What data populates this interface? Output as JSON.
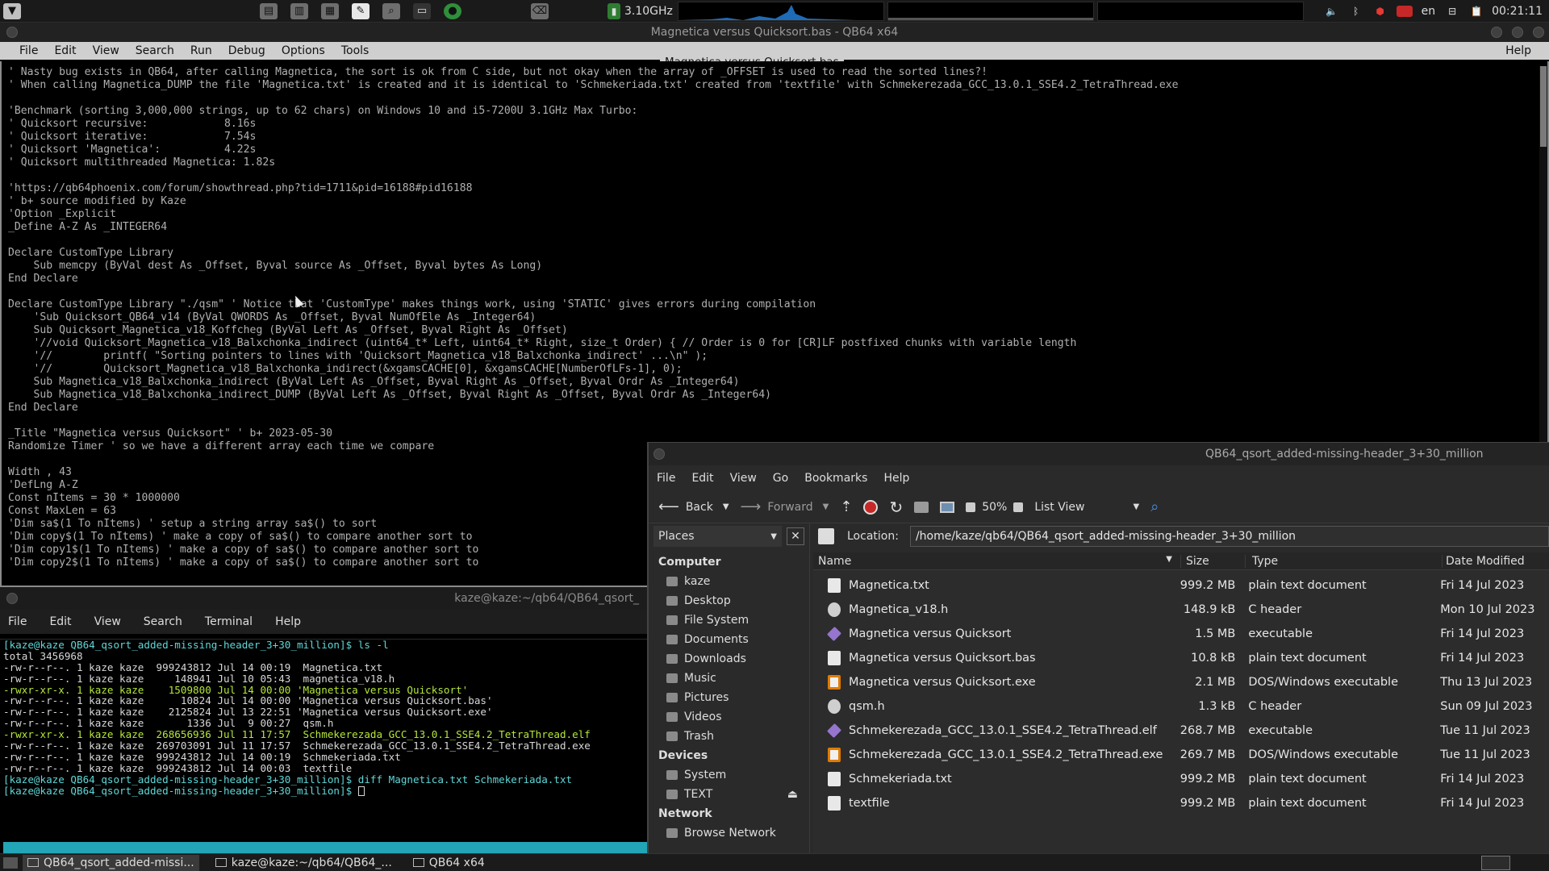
{
  "top_panel": {
    "launchers": [
      "menu-icon",
      "printer-icon",
      "document-icon",
      "calculator-icon",
      "text-editor-icon",
      "search-icon",
      "terminal-icon",
      "browser-icon",
      "trash-icon"
    ],
    "cpu_freq": "3.10GHz",
    "lang": "en",
    "clock": "00:21:11"
  },
  "editor": {
    "title": "Magnetica versus Quicksort.bas - QB64 x64",
    "tab_label": "Magnetica versus Quicksort.bas",
    "menu": [
      "File",
      "Edit",
      "View",
      "Search",
      "Run",
      "Debug",
      "Options",
      "Tools"
    ],
    "help": "Help",
    "lines": [
      "' Nasty bug exists in QB64, after calling Magnetica, the sort is ok from C side, but not okay when the array of _OFFSET is used to read the sorted lines?!",
      "' When calling Magnetica_DUMP the file 'Magnetica.txt' is created and it is identical to 'Schmekeriada.txt' created from 'textfile' with Schmekerezada_GCC_13.0.1_SSE4.2_TetraThread.exe",
      "",
      "'Benchmark (sorting 3,000,000 strings, up to 62 chars) on Windows 10 and i5-7200U 3.1GHz Max Turbo:",
      "' Quicksort recursive:            8.16s",
      "' Quicksort iterative:            7.54s",
      "' Quicksort 'Magnetica':          4.22s",
      "' Quicksort multithreaded Magnetica: 1.82s",
      "",
      "'https://qb64phoenix.com/forum/showthread.php?tid=1711&pid=16188#pid16188",
      "' b+ source modified by Kaze",
      "'Option _Explicit",
      "_Define A-Z As _INTEGER64",
      "",
      "Declare CustomType Library",
      "    Sub memcpy (ByVal dest As _Offset, Byval source As _Offset, Byval bytes As Long)",
      "End Declare",
      "",
      "Declare CustomType Library \"./qsm\" ' Notice that 'CustomType' makes things work, using 'STATIC' gives errors during compilation",
      "    'Sub Quicksort_QB64_v14 (ByVal QWORDS As _Offset, Byval NumOfEle As _Integer64)",
      "    Sub Quicksort_Magnetica_v18_Koffcheg (ByVal Left As _Offset, Byval Right As _Offset)",
      "    '//void Quicksort_Magnetica_v18_Balxchonka_indirect (uint64_t* Left, uint64_t* Right, size_t Order) { // Order is 0 for [CR]LF postfixed chunks with variable length",
      "    '//        printf( \"Sorting pointers to lines with 'Quicksort_Magnetica_v18_Balxchonka_indirect' ...\\n\" );",
      "    '//        Quicksort_Magnetica_v18_Balxchonka_indirect(&xgamsCACHE[0], &xgamsCACHE[NumberOfLFs-1], 0);",
      "    Sub Magnetica_v18_Balxchonka_indirect (ByVal Left As _Offset, Byval Right As _Offset, Byval Ordr As _Integer64)",
      "    Sub Magnetica_v18_Balxchonka_indirect_DUMP (ByVal Left As _Offset, Byval Right As _Offset, Byval Ordr As _Integer64)",
      "End Declare",
      "",
      "_Title \"Magnetica versus Quicksort\" ' b+ 2023-05-30",
      "Randomize Timer ' so we have a different array each time we compare",
      "",
      "Width , 43",
      "'DefLng A-Z",
      "Const nItems = 30 * 1000000",
      "Const MaxLen = 63",
      "'Dim sa$(1 To nItems) ' setup a string array sa$() to sort",
      "'Dim copy$(1 To nItems) ' make a copy of sa$() to compare another sort to",
      "'Dim copy1$(1 To nItems) ' make a copy of sa$() to compare another sort to",
      "'Dim copy2$(1 To nItems) ' make a copy of sa$() to compare another sort to"
    ]
  },
  "terminal": {
    "title": "kaze@kaze:~/qb64/QB64_qsort_",
    "menu": [
      "File",
      "Edit",
      "View",
      "Search",
      "Terminal",
      "Help"
    ],
    "lines": [
      {
        "t": "[kaze@kaze QB64_qsort_added-missing-header_3+30_million]$ ls -l",
        "c": "#5fd7d7"
      },
      {
        "t": "total 3456968",
        "c": "#d8d8d8"
      },
      {
        "t": "-rw-r--r--. 1 kaze kaze  999243812 Jul 14 00:19  Magnetica.txt",
        "c": "#d8d8d8"
      },
      {
        "t": "-rw-r--r--. 1 kaze kaze     148941 Jul 10 05:43  magnetica_v18.h",
        "c": "#d8d8d8"
      },
      {
        "t": "-rwxr-xr-x. 1 kaze kaze    1509800 Jul 14 00:00 'Magnetica versus Quicksort'",
        "c": "#b5e83a"
      },
      {
        "t": "-rw-r--r--. 1 kaze kaze      10824 Jul 14 00:00 'Magnetica versus Quicksort.bas'",
        "c": "#d8d8d8"
      },
      {
        "t": "-rw-r--r--. 1 kaze kaze    2125824 Jul 13 22:51 'Magnetica versus Quicksort.exe'",
        "c": "#d8d8d8"
      },
      {
        "t": "-rw-r--r--. 1 kaze kaze       1336 Jul  9 00:27  qsm.h",
        "c": "#d8d8d8"
      },
      {
        "t": "-rwxr-xr-x. 1 kaze kaze  268656936 Jul 11 17:57  Schmekerezada_GCC_13.0.1_SSE4.2_TetraThread.elf",
        "c": "#b5e83a"
      },
      {
        "t": "-rw-r--r--. 1 kaze kaze  269703091 Jul 11 17:57  Schmekerezada_GCC_13.0.1_SSE4.2_TetraThread.exe",
        "c": "#d8d8d8"
      },
      {
        "t": "-rw-r--r--. 1 kaze kaze  999243812 Jul 14 00:19  Schmekeriada.txt",
        "c": "#d8d8d8"
      },
      {
        "t": "-rw-r--r--. 1 kaze kaze  999243812 Jul 14 00:03  textfile",
        "c": "#d8d8d8"
      },
      {
        "t": "[kaze@kaze QB64_qsort_added-missing-header_3+30_million]$ diff Magnetica.txt Schmekeriada.txt",
        "c": "#5fd7d7"
      },
      {
        "t": "[kaze@kaze QB64_qsort_added-missing-header_3+30_million]$ ",
        "c": "#5fd7d7"
      }
    ]
  },
  "file_manager": {
    "title": "QB64_qsort_added-missing-header_3+30_million",
    "menu": [
      "File",
      "Edit",
      "View",
      "Go",
      "Bookmarks",
      "Help"
    ],
    "toolbar": {
      "back": "Back",
      "forward": "Forward",
      "zoom": "50%",
      "view_mode": "List View"
    },
    "places_label": "Places",
    "location_label": "Location:",
    "location_value": "/home/kaze/qb64/QB64_qsort_added-missing-header_3+30_million",
    "places": [
      {
        "kind": "head",
        "label": "Computer"
      },
      {
        "kind": "item",
        "label": "kaze"
      },
      {
        "kind": "item",
        "label": "Desktop"
      },
      {
        "kind": "item",
        "label": "File System"
      },
      {
        "kind": "item",
        "label": "Documents"
      },
      {
        "kind": "item",
        "label": "Downloads"
      },
      {
        "kind": "item",
        "label": "Music"
      },
      {
        "kind": "item",
        "label": "Pictures"
      },
      {
        "kind": "item",
        "label": "Videos"
      },
      {
        "kind": "item",
        "label": "Trash"
      },
      {
        "kind": "head",
        "label": "Devices"
      },
      {
        "kind": "item",
        "label": "System"
      },
      {
        "kind": "item",
        "label": "TEXT"
      },
      {
        "kind": "head",
        "label": "Network"
      },
      {
        "kind": "item",
        "label": "Browse Network"
      }
    ],
    "columns": [
      "Name",
      "Size",
      "Type",
      "Date Modified"
    ],
    "files": [
      {
        "name": "Magnetica.txt",
        "size": "999.2 MB",
        "type": "plain text document",
        "date": "Fri 14 Jul 2023",
        "icon": "text-file-icon"
      },
      {
        "name": "Magnetica_v18.h",
        "size": "148.9 kB",
        "type": "C header",
        "date": "Mon 10 Jul 2023",
        "icon": "c-header-icon"
      },
      {
        "name": "Magnetica versus Quicksort",
        "size": "1.5 MB",
        "type": "executable",
        "date": "Fri 14 Jul 2023",
        "icon": "executable-icon"
      },
      {
        "name": "Magnetica versus Quicksort.bas",
        "size": "10.8 kB",
        "type": "plain text document",
        "date": "Fri 14 Jul 2023",
        "icon": "text-file-icon"
      },
      {
        "name": "Magnetica versus Quicksort.exe",
        "size": "2.1 MB",
        "type": "DOS/Windows executable",
        "date": "Thu 13 Jul 2023",
        "icon": "windows-exe-icon"
      },
      {
        "name": "qsm.h",
        "size": "1.3 kB",
        "type": "C header",
        "date": "Sun 09 Jul 2023",
        "icon": "c-header-icon"
      },
      {
        "name": "Schmekerezada_GCC_13.0.1_SSE4.2_TetraThread.elf",
        "size": "268.7 MB",
        "type": "executable",
        "date": "Tue 11 Jul 2023",
        "icon": "executable-icon"
      },
      {
        "name": "Schmekerezada_GCC_13.0.1_SSE4.2_TetraThread.exe",
        "size": "269.7 MB",
        "type": "DOS/Windows executable",
        "date": "Tue 11 Jul 2023",
        "icon": "windows-exe-icon"
      },
      {
        "name": "Schmekeriada.txt",
        "size": "999.2 MB",
        "type": "plain text document",
        "date": "Fri 14 Jul 2023",
        "icon": "text-file-icon"
      },
      {
        "name": "textfile",
        "size": "999.2 MB",
        "type": "plain text document",
        "date": "Fri 14 Jul 2023",
        "icon": "text-file-icon"
      }
    ]
  },
  "taskbar": {
    "items": [
      {
        "label": "QB64_qsort_added-missi...",
        "icon": "folder-icon",
        "active": true
      },
      {
        "label": "kaze@kaze:~/qb64/QB64_...",
        "icon": "terminal-icon",
        "active": false
      },
      {
        "label": "QB64 x64",
        "icon": "window-icon",
        "active": false
      }
    ]
  },
  "colors": {
    "accent_cyan": "#5fd7d7",
    "exec_green": "#b5e83a",
    "editor_text": "#b0b0b0",
    "graph_blue": "#1e6bb8"
  }
}
